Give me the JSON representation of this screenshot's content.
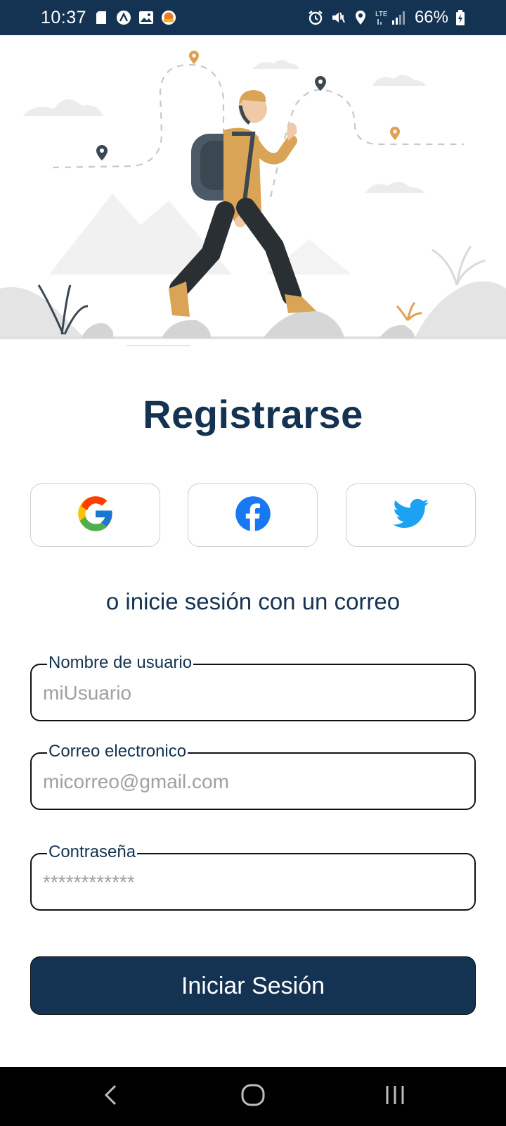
{
  "status_bar": {
    "time": "10:37",
    "battery": "66%",
    "network": "LTE",
    "icons": [
      "sd-card-icon",
      "app-icon",
      "gallery-icon",
      "notification-icon",
      "alarm-icon",
      "mute-icon",
      "location-icon",
      "signal-icon",
      "battery-icon"
    ]
  },
  "hero": {
    "icon": "hiker-illustration"
  },
  "title": "Registrarse",
  "social": {
    "google": "google-icon",
    "facebook": "facebook-icon",
    "twitter": "twitter-icon"
  },
  "subtitle": "o inicie sesión con un correo",
  "form": {
    "username": {
      "label": "Nombre de usuario",
      "placeholder": "miUsuario",
      "value": ""
    },
    "email": {
      "label": "Correo electronico",
      "placeholder": "micorreo@gmail.com",
      "value": ""
    },
    "password": {
      "label": "Contraseña",
      "placeholder": "************",
      "value": ""
    }
  },
  "login_button": "Iniciar Sesión",
  "colors": {
    "primary": "#143352",
    "border": "#111111",
    "placeholder": "#a0a0a0",
    "accent_orange": "#e0a050"
  }
}
